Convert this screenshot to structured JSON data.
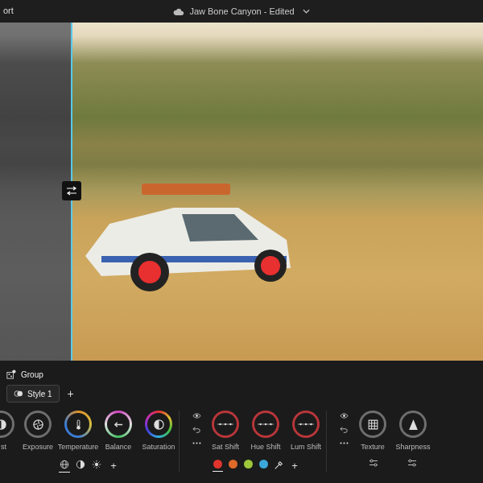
{
  "top_bar": {
    "left_text": "ort",
    "title": "Jaw Bone Canyon - Edited"
  },
  "compare": {
    "level": 0.147
  },
  "group": {
    "label": "Group"
  },
  "styles": [
    {
      "label": "Style 1",
      "selected": true
    }
  ],
  "add_style": "+",
  "light_tools": [
    {
      "label": "st",
      "kind": "contrast"
    },
    {
      "label": "Exposure",
      "kind": "exposure"
    },
    {
      "label": "Temperature",
      "kind": "temperature"
    },
    {
      "label": "Balance",
      "kind": "balance"
    },
    {
      "label": "Saturation",
      "kind": "saturation"
    }
  ],
  "scope_modes": [
    {
      "kind": "global",
      "selected": true
    },
    {
      "kind": "luminance",
      "selected": false
    },
    {
      "kind": "light",
      "selected": false
    }
  ],
  "scope_add": "+",
  "color_tools": [
    {
      "label": "Sat Shift"
    },
    {
      "label": "Hue Shift"
    },
    {
      "label": "Lum Shift"
    }
  ],
  "swatches": [
    {
      "color": "#e0342e",
      "selected": true
    },
    {
      "color": "#e06a2a",
      "selected": false
    },
    {
      "color": "#9cc83a",
      "selected": false
    },
    {
      "color": "#3aa8d8",
      "selected": false
    }
  ],
  "swatch_add": "+",
  "detail_tools": [
    {
      "label": "Texture",
      "kind": "texture"
    },
    {
      "label": "Sharpness",
      "kind": "sharpness"
    }
  ]
}
